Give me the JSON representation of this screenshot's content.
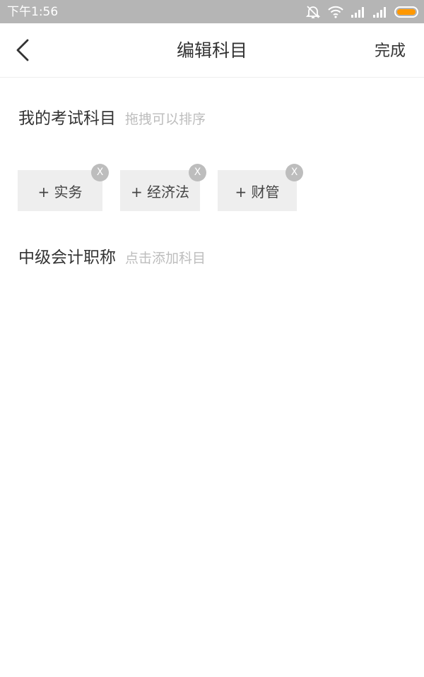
{
  "status_bar": {
    "time": "下午1:56",
    "icons": [
      "alarm-off-icon",
      "wifi-icon",
      "signal-icon",
      "signal-icon",
      "battery-icon"
    ],
    "battery_color": "#ff9800"
  },
  "nav": {
    "title": "编辑科目",
    "done_label": "完成",
    "back_icon": "chevron-left-icon"
  },
  "my_subjects": {
    "title": "我的考试科目",
    "hint": "拖拽可以排序",
    "items": [
      {
        "label": "+ 实务",
        "remove_label": "X"
      },
      {
        "label": "+ 经济法",
        "remove_label": "X"
      },
      {
        "label": "+ 财管",
        "remove_label": "X"
      }
    ]
  },
  "available": {
    "title": "中级会计职称",
    "hint": "点击添加科目"
  }
}
